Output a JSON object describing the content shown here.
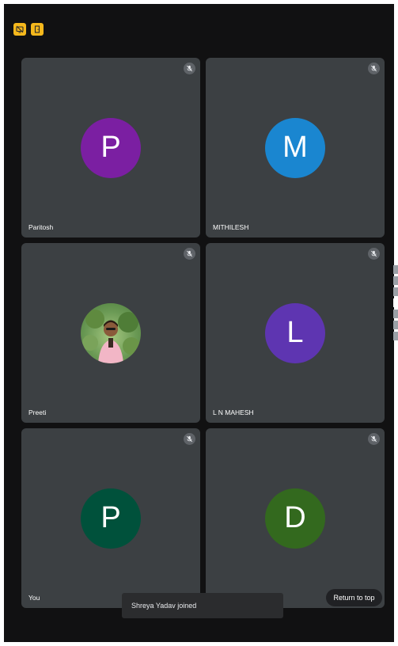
{
  "top_icons": [
    "screen-share-off-icon",
    "door-icon"
  ],
  "participants": [
    {
      "name": "Paritosh",
      "initial": "P",
      "color": "#7b1fa2",
      "muted": true,
      "has_photo": false
    },
    {
      "name": "MITHILESH",
      "initial": "M",
      "color": "#1a86d0",
      "muted": true,
      "has_photo": false
    },
    {
      "name": "Preeti",
      "initial": "",
      "color": "#6b9a55",
      "muted": true,
      "has_photo": true
    },
    {
      "name": "L N MAHESH",
      "initial": "L",
      "color": "#5e35b1",
      "muted": true,
      "has_photo": false
    },
    {
      "name": "You",
      "initial": "P",
      "color": "#00513b",
      "muted": true,
      "has_photo": false
    },
    {
      "name": "",
      "initial": "D",
      "color": "#33691e",
      "muted": true,
      "has_photo": false
    }
  ],
  "toast": {
    "text": "Shreya Yadav joined"
  },
  "return_button": {
    "label": "Return to top"
  },
  "colors": {
    "background": "#111112",
    "tile": "#3c4043",
    "accent": "#f5b81c"
  }
}
